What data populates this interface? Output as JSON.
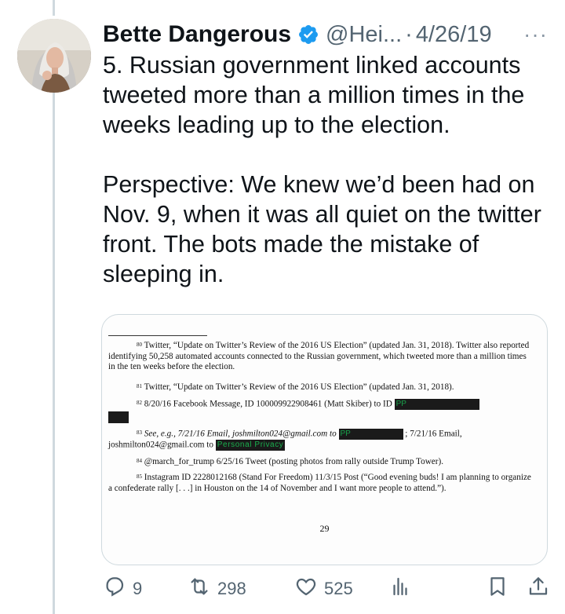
{
  "author": {
    "name": "Bette Dangerous",
    "handle": "@Hei...",
    "separator": "·",
    "date": "4/26/19"
  },
  "tweet": {
    "paragraph_1": "5. Russian government linked accounts tweeted more than a million times in the weeks leading up to the election.",
    "paragraph_2": "Perspective: We knew we’d been had on Nov. 9, when it was all quiet on the twitter front. The bots made the mistake of sleeping in."
  },
  "document": {
    "fn80_num": "80",
    "fn80_text": "Twitter, “Update on Twitter’s Review of the 2016 US Election” (updated Jan. 31, 2018).  Twitter also reported identifying 50,258 automated accounts connected to the Russian government, which tweeted more than a million times in the ten weeks before the election.",
    "fn81_num": "81",
    "fn81_text": "Twitter, “Update on Twitter’s Review of the 2016 US Election” (updated Jan. 31, 2018).",
    "fn82_num": "82",
    "fn82_text": "8/20/16 Facebook Message, ID 100009922908461 (Matt Skiber) to ID",
    "fn82_redaction": "PP",
    "fn83_num": "83",
    "fn83_text_a": "See, e.g., 7/21/16  Email, joshmilton024@gmail.com  to",
    "fn83_redaction_1": "PP",
    "fn83_text_b": "; 7/21/16 Email,",
    "fn83_text_c": "joshmilton024@gmail.com to",
    "fn83_redaction_2": "Personal Privacy",
    "fn84_num": "84",
    "fn84_text": "@march_for_trump 6/25/16 Tweet (posting photos from rally outside Trump Tower).",
    "fn85_num": "85",
    "fn85_text": "Instagram ID 2228012168 (Stand For Freedom) 11/3/15 Post (“Good evening buds! I am planning to organize a confederate rally [. . .] in Houston on the 14 of November and I want more people to attend.”).",
    "page_number": "29"
  },
  "actions": {
    "replies": "9",
    "retweets": "298",
    "likes": "525"
  },
  "colors": {
    "verified_blue": "#1d9bf0",
    "secondary_text": "#536471",
    "redaction_text": "#18a04a"
  },
  "icons": [
    "verified-badge-icon",
    "more-icon",
    "reply-icon",
    "retweet-icon",
    "like-icon",
    "views-icon",
    "bookmark-icon",
    "share-icon"
  ]
}
